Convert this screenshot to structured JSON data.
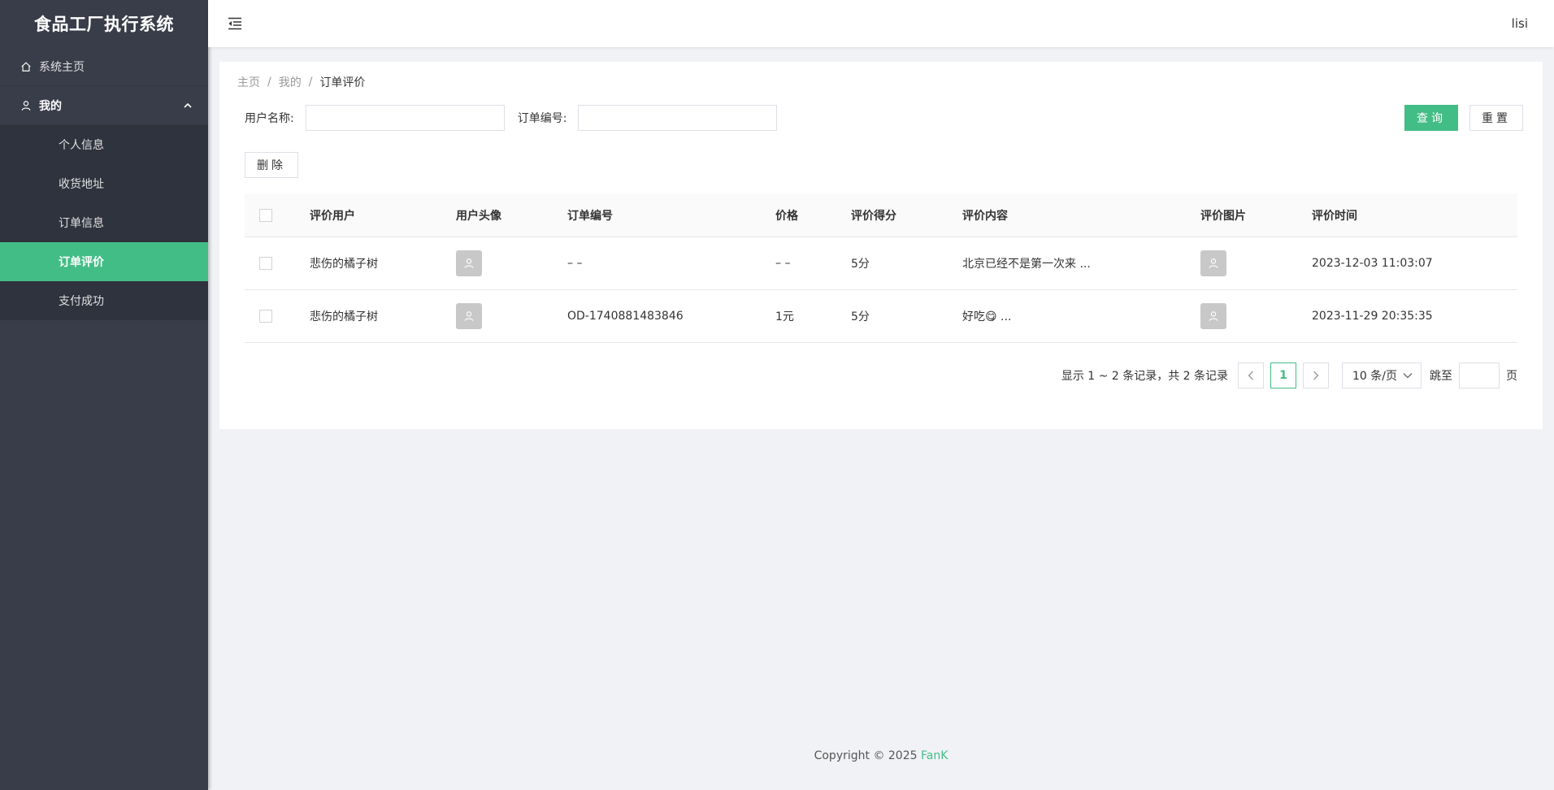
{
  "app": {
    "title": "食品工厂执行系统"
  },
  "colors": {
    "accent": "#43bd86",
    "sidebar_bg": "#393d49"
  },
  "sidebar": {
    "home": {
      "label": "系统主页",
      "icon": "home-icon"
    },
    "mine": {
      "label": "我的",
      "icon": "user-icon",
      "items": [
        {
          "label": "个人信息"
        },
        {
          "label": "收货地址"
        },
        {
          "label": "订单信息"
        },
        {
          "label": "订单评价"
        },
        {
          "label": "支付成功"
        }
      ]
    }
  },
  "header": {
    "username": "lisi"
  },
  "breadcrumb": {
    "home": "主页",
    "parent": "我的",
    "current": "订单评价",
    "sep": "/"
  },
  "search": {
    "user_label": "用户名称:",
    "user_value": "",
    "order_label": "订单编号:",
    "order_value": "",
    "query_label": "查询",
    "reset_label": "重置"
  },
  "toolbar": {
    "delete_label": "删除"
  },
  "table": {
    "headers": {
      "user": "评价用户",
      "avatar": "用户头像",
      "order": "订单编号",
      "price": "价格",
      "score": "评价得分",
      "content": "评价内容",
      "image": "评价图片",
      "time": "评价时间"
    },
    "rows": [
      {
        "user": "悲伤的橘子树",
        "order": "– –",
        "price": "– –",
        "score": "5分",
        "content": "北京已经不是第一次来 ...",
        "time": "2023-12-03 11:03:07"
      },
      {
        "user": "悲伤的橘子树",
        "order": "OD-1740881483846",
        "price": "1元",
        "score": "5分",
        "content": "好吃😋 ...",
        "time": "2023-11-29 20:35:35"
      }
    ]
  },
  "pagination": {
    "total_text": "显示 1 ~ 2 条记录，共 2 条记录",
    "current_page": "1",
    "page_size": "10 条/页",
    "jump_label": "跳至",
    "jump_value": "",
    "jump_suffix": "页"
  },
  "footer": {
    "copyright": "Copyright © 2025 ",
    "author": "FanK"
  }
}
